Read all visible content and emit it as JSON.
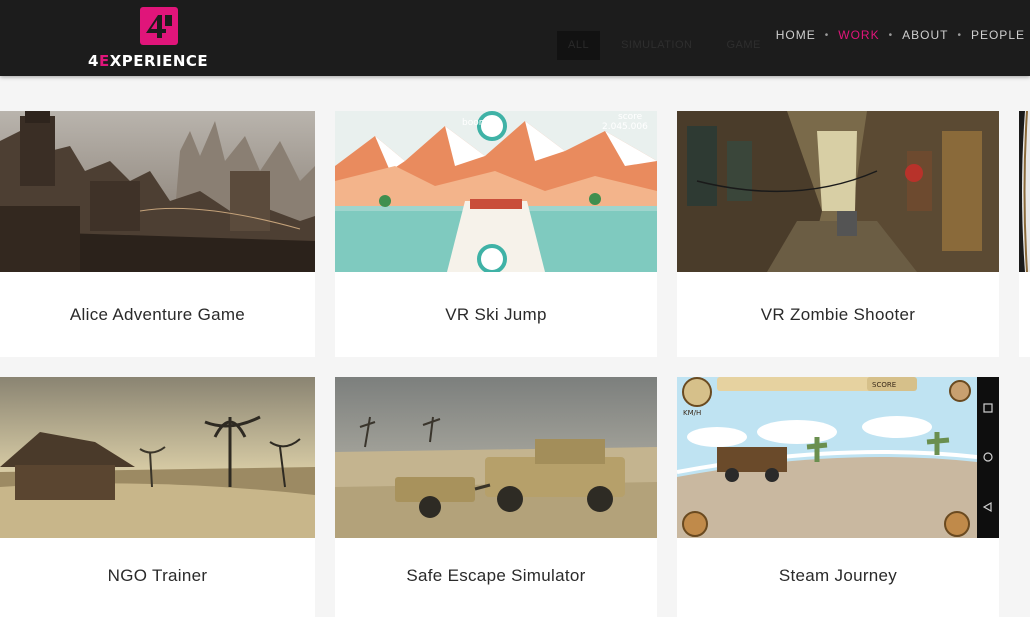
{
  "brand": {
    "prefix": "4",
    "accent": "E",
    "suffix": "XPERIENCE",
    "accent_color": "#e0157a"
  },
  "filters": [
    {
      "label": "ALL",
      "active": true
    },
    {
      "label": "SIMULATION",
      "active": false
    },
    {
      "label": "GAME",
      "active": false
    }
  ],
  "nav": [
    {
      "label": "HOME",
      "active": false
    },
    {
      "label": "WORK",
      "active": true
    },
    {
      "label": "ABOUT",
      "active": false
    },
    {
      "label": "PEOPLE",
      "active": false
    }
  ],
  "projects": [
    {
      "title": "Alice Adventure Game",
      "image": "ruined-city-scene"
    },
    {
      "title": "VR Ski Jump",
      "image": "ski-jump-scene"
    },
    {
      "title": "VR Zombie Shooter",
      "image": "alley-scene"
    },
    {
      "title": "NGO Trainer",
      "image": "hut-savanna-scene"
    },
    {
      "title": "Safe Escape Simulator",
      "image": "desert-vehicle-scene"
    },
    {
      "title": "Steam Journey",
      "image": "steampunk-game-scene"
    }
  ],
  "ski_hud": {
    "boom": "boom!",
    "score_label": "score",
    "score_value": "2.045.006"
  },
  "steam_hud": {
    "score_label": "SCORE",
    "speed_unit": "KM/H"
  }
}
